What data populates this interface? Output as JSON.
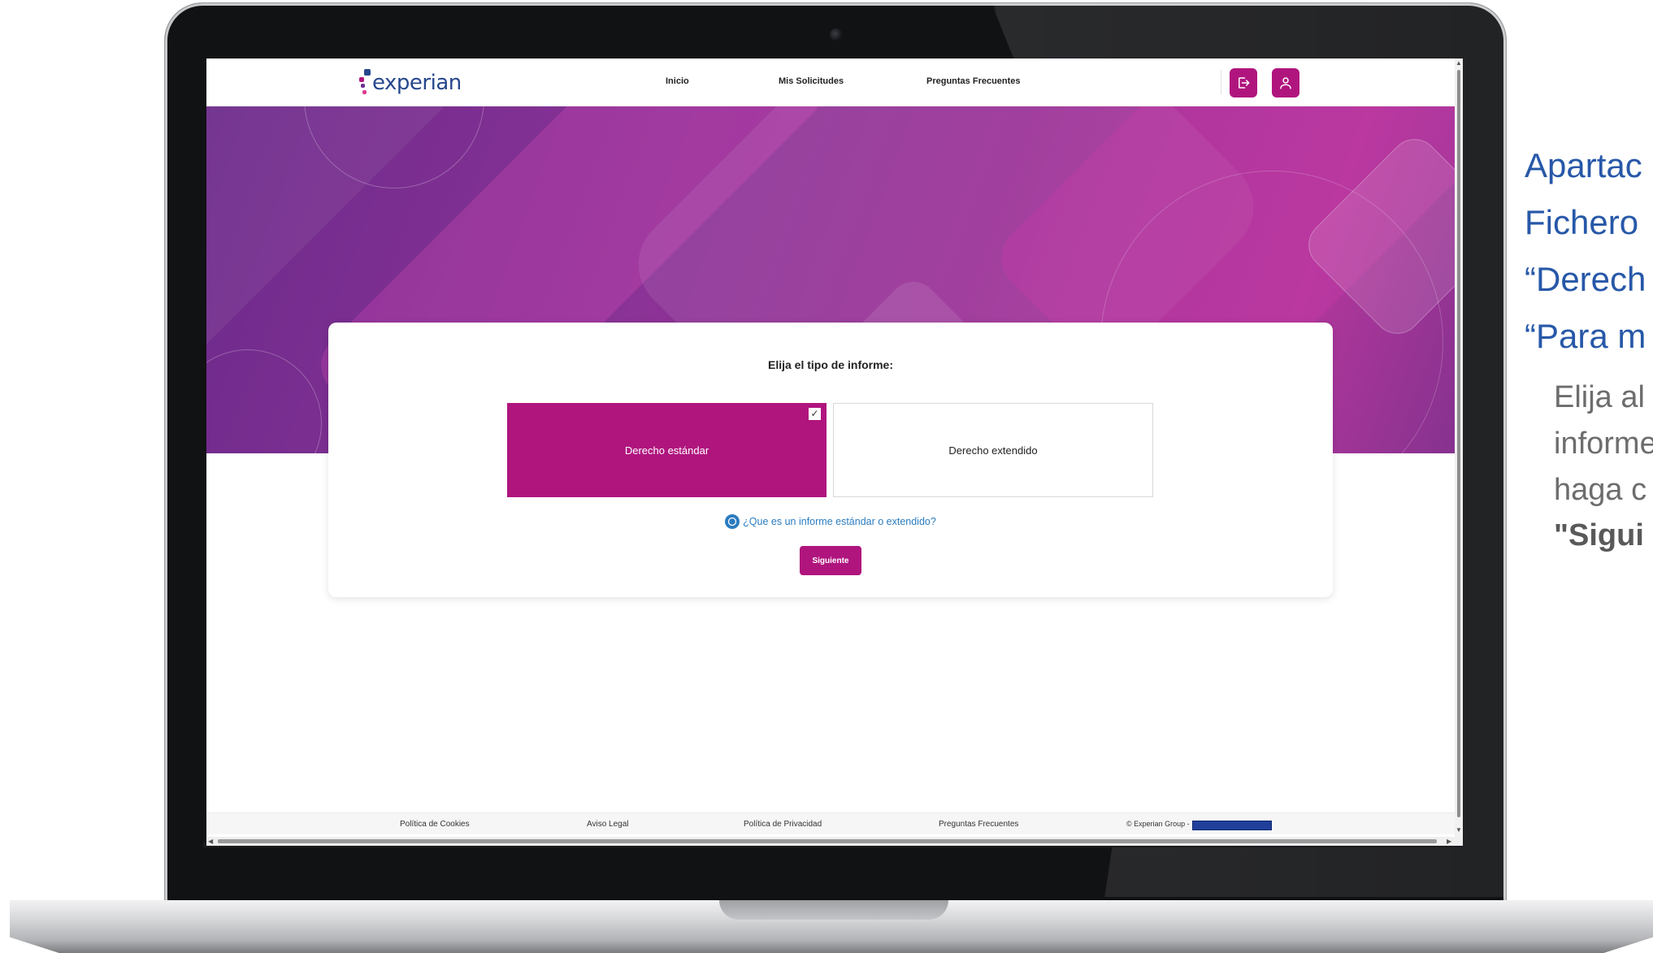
{
  "nav": {
    "links": [
      "Inicio",
      "Mis Solicitudes",
      "Preguntas Frecuentes"
    ],
    "logo_text": "experian",
    "logout_icon": "logout-icon",
    "user_icon": "user-icon"
  },
  "card": {
    "title": "Elija el tipo de informe:",
    "options": [
      {
        "label": "Derecho estándar",
        "selected": true
      },
      {
        "label": "Derecho extendido",
        "selected": false
      }
    ],
    "check_mark": "✓",
    "help_link": "¿Que es un informe estándar o extendido?",
    "next_button": "Siguiente"
  },
  "footer": {
    "links": [
      "Política de Cookies",
      "Aviso Legal",
      "Política de Privacidad",
      "Preguntas Frecuentes",
      "© Experian Group -"
    ]
  },
  "side_text": {
    "headings": [
      "Apartac",
      "Fichero",
      "“Derech",
      "“Para m"
    ],
    "body": [
      "Elija al",
      "informe",
      "haga c",
      "\"Sigui"
    ]
  },
  "colors": {
    "brand": "#b0157e",
    "link": "#2a7cc0",
    "logo_blue": "#26478d",
    "side_heading": "#2758a8"
  }
}
